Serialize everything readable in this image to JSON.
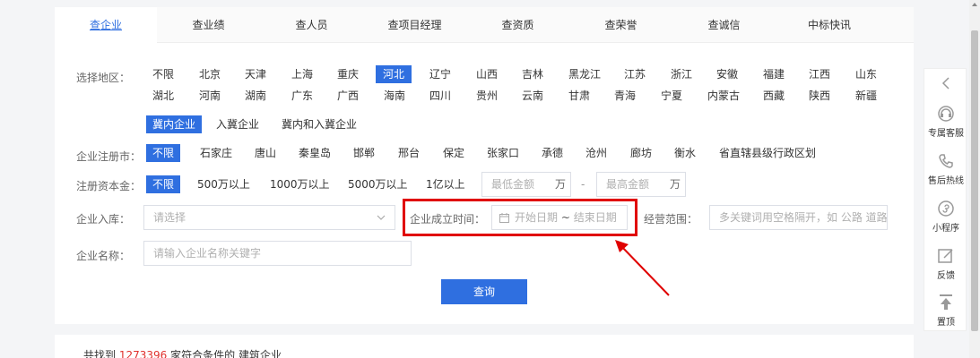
{
  "tabs": [
    "查企业",
    "查业绩",
    "查人员",
    "查项目经理",
    "查资质",
    "查荣誉",
    "查诚信",
    "中标快讯"
  ],
  "region": {
    "label": "选择地区：",
    "row1": [
      "不限",
      "北京",
      "天津",
      "上海",
      "重庆",
      "河北",
      "辽宁",
      "山西",
      "吉林",
      "黑龙江",
      "江苏",
      "浙江",
      "安徽",
      "福建",
      "江西",
      "山东"
    ],
    "row2": [
      "湖北",
      "河南",
      "湖南",
      "广东",
      "广西",
      "海南",
      "四川",
      "贵州",
      "云南",
      "甘肃",
      "青海",
      "宁夏",
      "内蒙古",
      "西藏",
      "陕西",
      "新疆"
    ],
    "selected": "河北",
    "sub_options": [
      "冀内企业",
      "入冀企业",
      "冀内和入冀企业"
    ],
    "sub_selected": "冀内企业"
  },
  "city": {
    "label": "企业注册市：",
    "options": [
      "不限",
      "石家庄",
      "唐山",
      "秦皇岛",
      "邯郸",
      "邢台",
      "保定",
      "张家口",
      "承德",
      "沧州",
      "廊坊",
      "衡水",
      "省直辖县级行政区划"
    ],
    "selected": "不限"
  },
  "capital": {
    "label": "注册资本金：",
    "options": [
      "不限",
      "500万以上",
      "1000万以上",
      "5000万以上",
      "1亿以上"
    ],
    "selected": "不限",
    "min_placeholder": "最低金额",
    "max_placeholder": "最高金额",
    "unit": "万",
    "dash": "-"
  },
  "entry": {
    "label": "企业入库：",
    "placeholder": "请选择"
  },
  "founded": {
    "label": "企业成立时间：",
    "start_placeholder": "开始日期",
    "separator": "~",
    "end_placeholder": "结束日期"
  },
  "scope": {
    "label": "经营范围：",
    "placeholder": "多关键词用空格隔开，如 公路 道路"
  },
  "name": {
    "label": "企业名称：",
    "placeholder": "请输入企业名称关键字"
  },
  "query_label": "查询",
  "result": {
    "prefix": "共找到",
    "count": "1273396",
    "suffix": "家符合条件的 建筑企业"
  },
  "sidebar": [
    "专属客服",
    "售后热线",
    "小程序",
    "反馈",
    "置顶"
  ],
  "colors": {
    "accent": "#2f6fe0",
    "highlight": "#e00000",
    "count": "#e0322e"
  }
}
